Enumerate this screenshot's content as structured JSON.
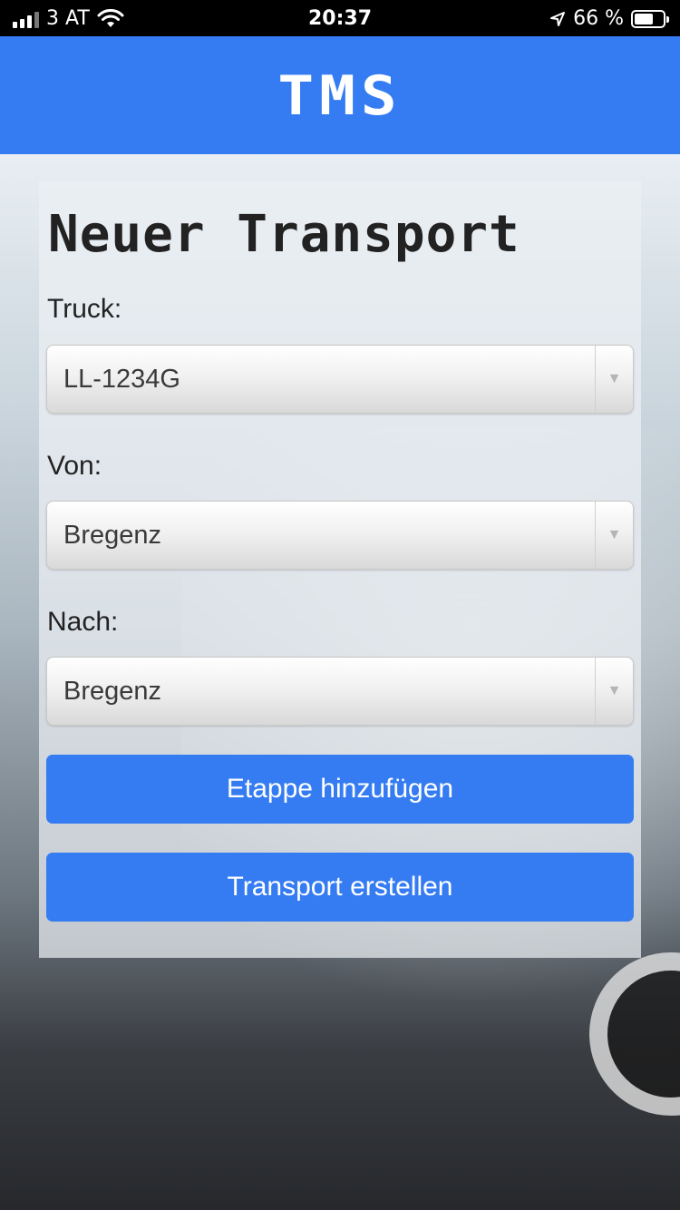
{
  "status_bar": {
    "carrier": "3 AT",
    "time": "20:37",
    "battery_percent": "66 %",
    "battery_level": 0.66
  },
  "header": {
    "title": "TMS"
  },
  "form": {
    "title": "Neuer Transport",
    "truck": {
      "label": "Truck:",
      "value": "LL-1234G"
    },
    "from": {
      "label": "Von:",
      "value": "Bregenz"
    },
    "to": {
      "label": "Nach:",
      "value": "Bregenz"
    },
    "add_stage_button": "Etappe hinzufügen",
    "create_button": "Transport erstellen"
  },
  "colors": {
    "accent": "#357cf3"
  }
}
